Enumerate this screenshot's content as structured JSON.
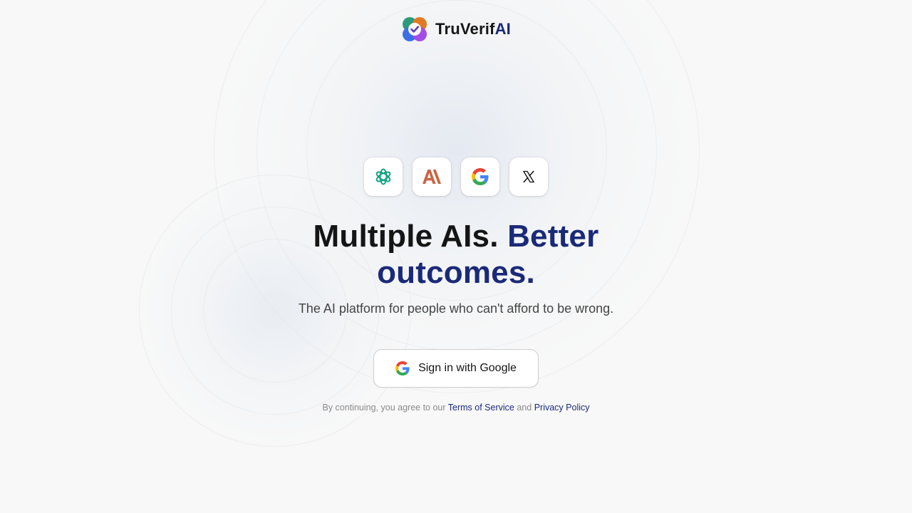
{
  "brand": {
    "name_prefix": "TruVerif",
    "name_accent": "AI",
    "colors": {
      "accent": "#1a2a78",
      "mark_green": "#2e9a7d",
      "mark_orange": "#e07b24",
      "mark_blue": "#3b6fe8",
      "mark_purple": "#a24de6"
    }
  },
  "providers": [
    {
      "icon": "openai-icon",
      "color": "#10a37f"
    },
    {
      "icon": "anthropic-icon",
      "color": "#c96442"
    },
    {
      "icon": "google-icon",
      "color": "#4285f4"
    },
    {
      "icon": "x-icon",
      "color": "#111111"
    }
  ],
  "hero": {
    "headline_plain": "Multiple AIs.",
    "headline_accent": "Better outcomes.",
    "subtitle": "The AI platform for people who can't afford to be wrong."
  },
  "signin": {
    "label": "Sign in with Google",
    "icon": "google-icon"
  },
  "legal": {
    "prefix": "By continuing, you agree to our",
    "terms_label": "Terms of Service",
    "joiner": "and",
    "privacy_label": "Privacy Policy"
  }
}
